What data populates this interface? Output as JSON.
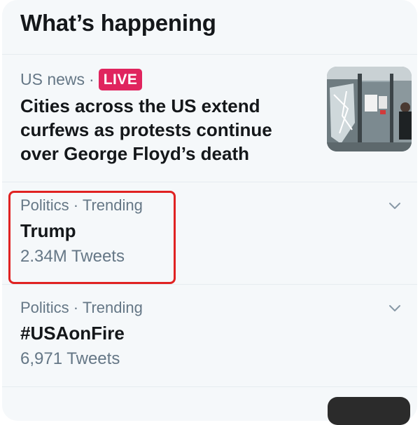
{
  "header": {
    "title": "What’s happening"
  },
  "news": {
    "category": "US news",
    "separator": "·",
    "badge": "LIVE",
    "headline": "Cities across the US extend curfews as protests continue over George Floyd’s death"
  },
  "trends": [
    {
      "category": "Politics · Trending",
      "name": "Trump",
      "count": "2.34M Tweets"
    },
    {
      "category": "Politics · Trending",
      "name": "#USAonFire",
      "count": "6,971 Tweets"
    }
  ],
  "colors": {
    "accent_live": "#e0245e",
    "highlight_box": "#e02222",
    "panel_bg": "#f5f8fa",
    "muted_text": "#657786"
  },
  "icons": {
    "trend_menu": "chevron-down-icon"
  }
}
